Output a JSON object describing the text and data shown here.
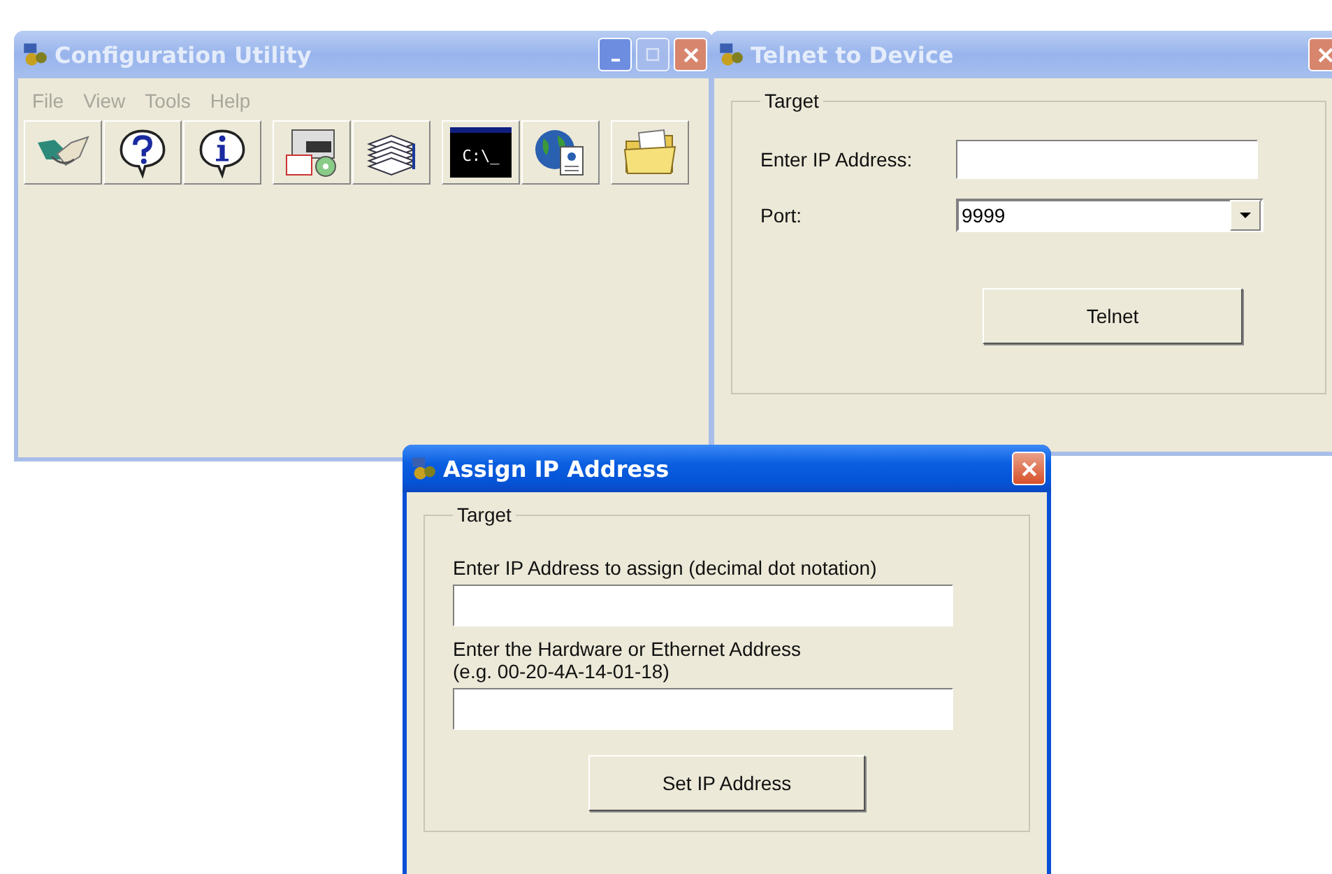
{
  "config_window": {
    "title": "Configuration Utility",
    "active": false,
    "menu": [
      {
        "label": "File",
        "disabled": true
      },
      {
        "label": "View",
        "disabled": true
      },
      {
        "label": "Tools",
        "disabled": true
      },
      {
        "label": "Help",
        "disabled": true
      }
    ],
    "toolbar": [
      [
        {
          "kind": "handshake"
        },
        {
          "kind": "help"
        },
        {
          "kind": "info"
        }
      ],
      [
        {
          "kind": "flash"
        },
        {
          "kind": "pages"
        }
      ],
      [
        {
          "kind": "terminal",
          "text": "C:\\_"
        },
        {
          "kind": "globe"
        }
      ],
      [
        {
          "kind": "folder"
        }
      ]
    ]
  },
  "telnet_window": {
    "title": "Telnet to Device",
    "active": false,
    "group": "Target",
    "ip_label": "Enter IP Address:",
    "port_label": "Port:",
    "port_value": "9999",
    "button": "Telnet"
  },
  "assign_window": {
    "title": "Assign IP Address",
    "active": true,
    "group": "Target",
    "ip_label": "Enter IP Address to assign (decimal dot notation)",
    "hw_label": [
      "Enter the Hardware or Ethernet Address",
      "(e.g. 00-20-4A-14-01-18)"
    ],
    "button": "Set IP Address"
  }
}
